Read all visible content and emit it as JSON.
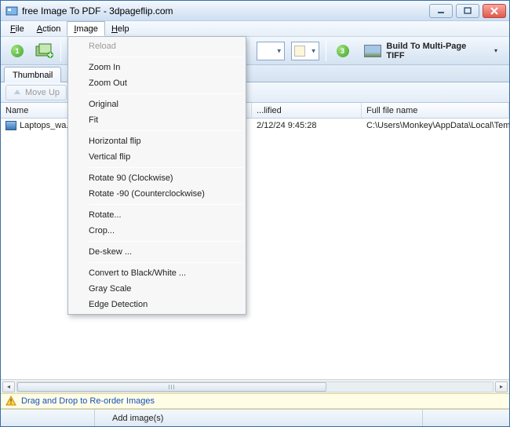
{
  "titlebar": {
    "title": "free Image To PDF - 3dpageflip.com"
  },
  "menubar": {
    "file": "File",
    "action": "Action",
    "image": "Image",
    "help": "Help"
  },
  "image_menu": {
    "reload": "Reload",
    "zoom_in": "Zoom In",
    "zoom_out": "Zoom Out",
    "original": "Original",
    "fit": "Fit",
    "hflip": "Horizontal flip",
    "vflip": "Vertical flip",
    "rot90cw": "Rotate 90 (Clockwise)",
    "rot90ccw": "Rotate -90 (Counterclockwise)",
    "rotate": "Rotate...",
    "crop": "Crop...",
    "deskew": "De-skew ...",
    "bw": "Convert to Black/White ...",
    "gray": "Gray Scale",
    "edge": "Edge Detection"
  },
  "toolbar": {
    "badge1": "1",
    "badge3": "3",
    "build_label": "Build To Multi-Page TIFF"
  },
  "tabs": {
    "thumbnail": "Thumbnail"
  },
  "subbar": {
    "moveup": "Move Up"
  },
  "list": {
    "cols": {
      "name": "Name",
      "modified": "...lified",
      "full": "Full file name"
    },
    "rows": [
      {
        "name": "Laptops_wa...",
        "modified": "2/12/24 9:45:28",
        "full": "C:\\Users\\Monkey\\AppData\\Local\\Temp"
      }
    ]
  },
  "hint": {
    "text": "Drag and Drop to Re-order Images"
  },
  "status": {
    "add_images": "Add image(s)"
  }
}
